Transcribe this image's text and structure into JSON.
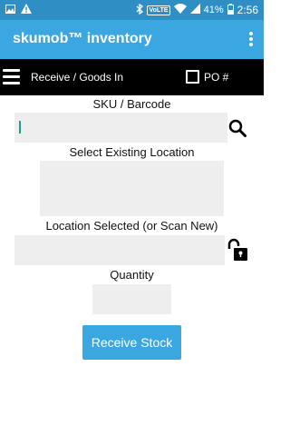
{
  "status_bar": {
    "battery": "41%",
    "time": "2:56",
    "network_badge": "VoLTE",
    "icons": [
      "image-icon",
      "warning-icon",
      "bluetooth-icon",
      "wifi-icon",
      "signal-icon",
      "battery-icon"
    ]
  },
  "app_bar": {
    "title": "skumob™ inventory",
    "menu_icon": "overflow-menu-icon"
  },
  "toolbar": {
    "title": "Receive / Goods In",
    "po_label": "PO #",
    "po_checked": false
  },
  "form": {
    "sku_label": "SKU / Barcode",
    "sku_value": "",
    "location_label": "Select Existing Location",
    "location_selected_label": "Location Selected (or Scan New)",
    "location_selected_value": "",
    "quantity_label": "Quantity",
    "quantity_value": "",
    "submit_label": "Receive Stock"
  },
  "colors": {
    "status_bar": "#2f8fc4",
    "app_bar": "#3ba7e0",
    "toolbar": "#000000",
    "field_bg": "#eeeeee",
    "button": "#3ba7e0",
    "cursor": "#1aa38a"
  }
}
